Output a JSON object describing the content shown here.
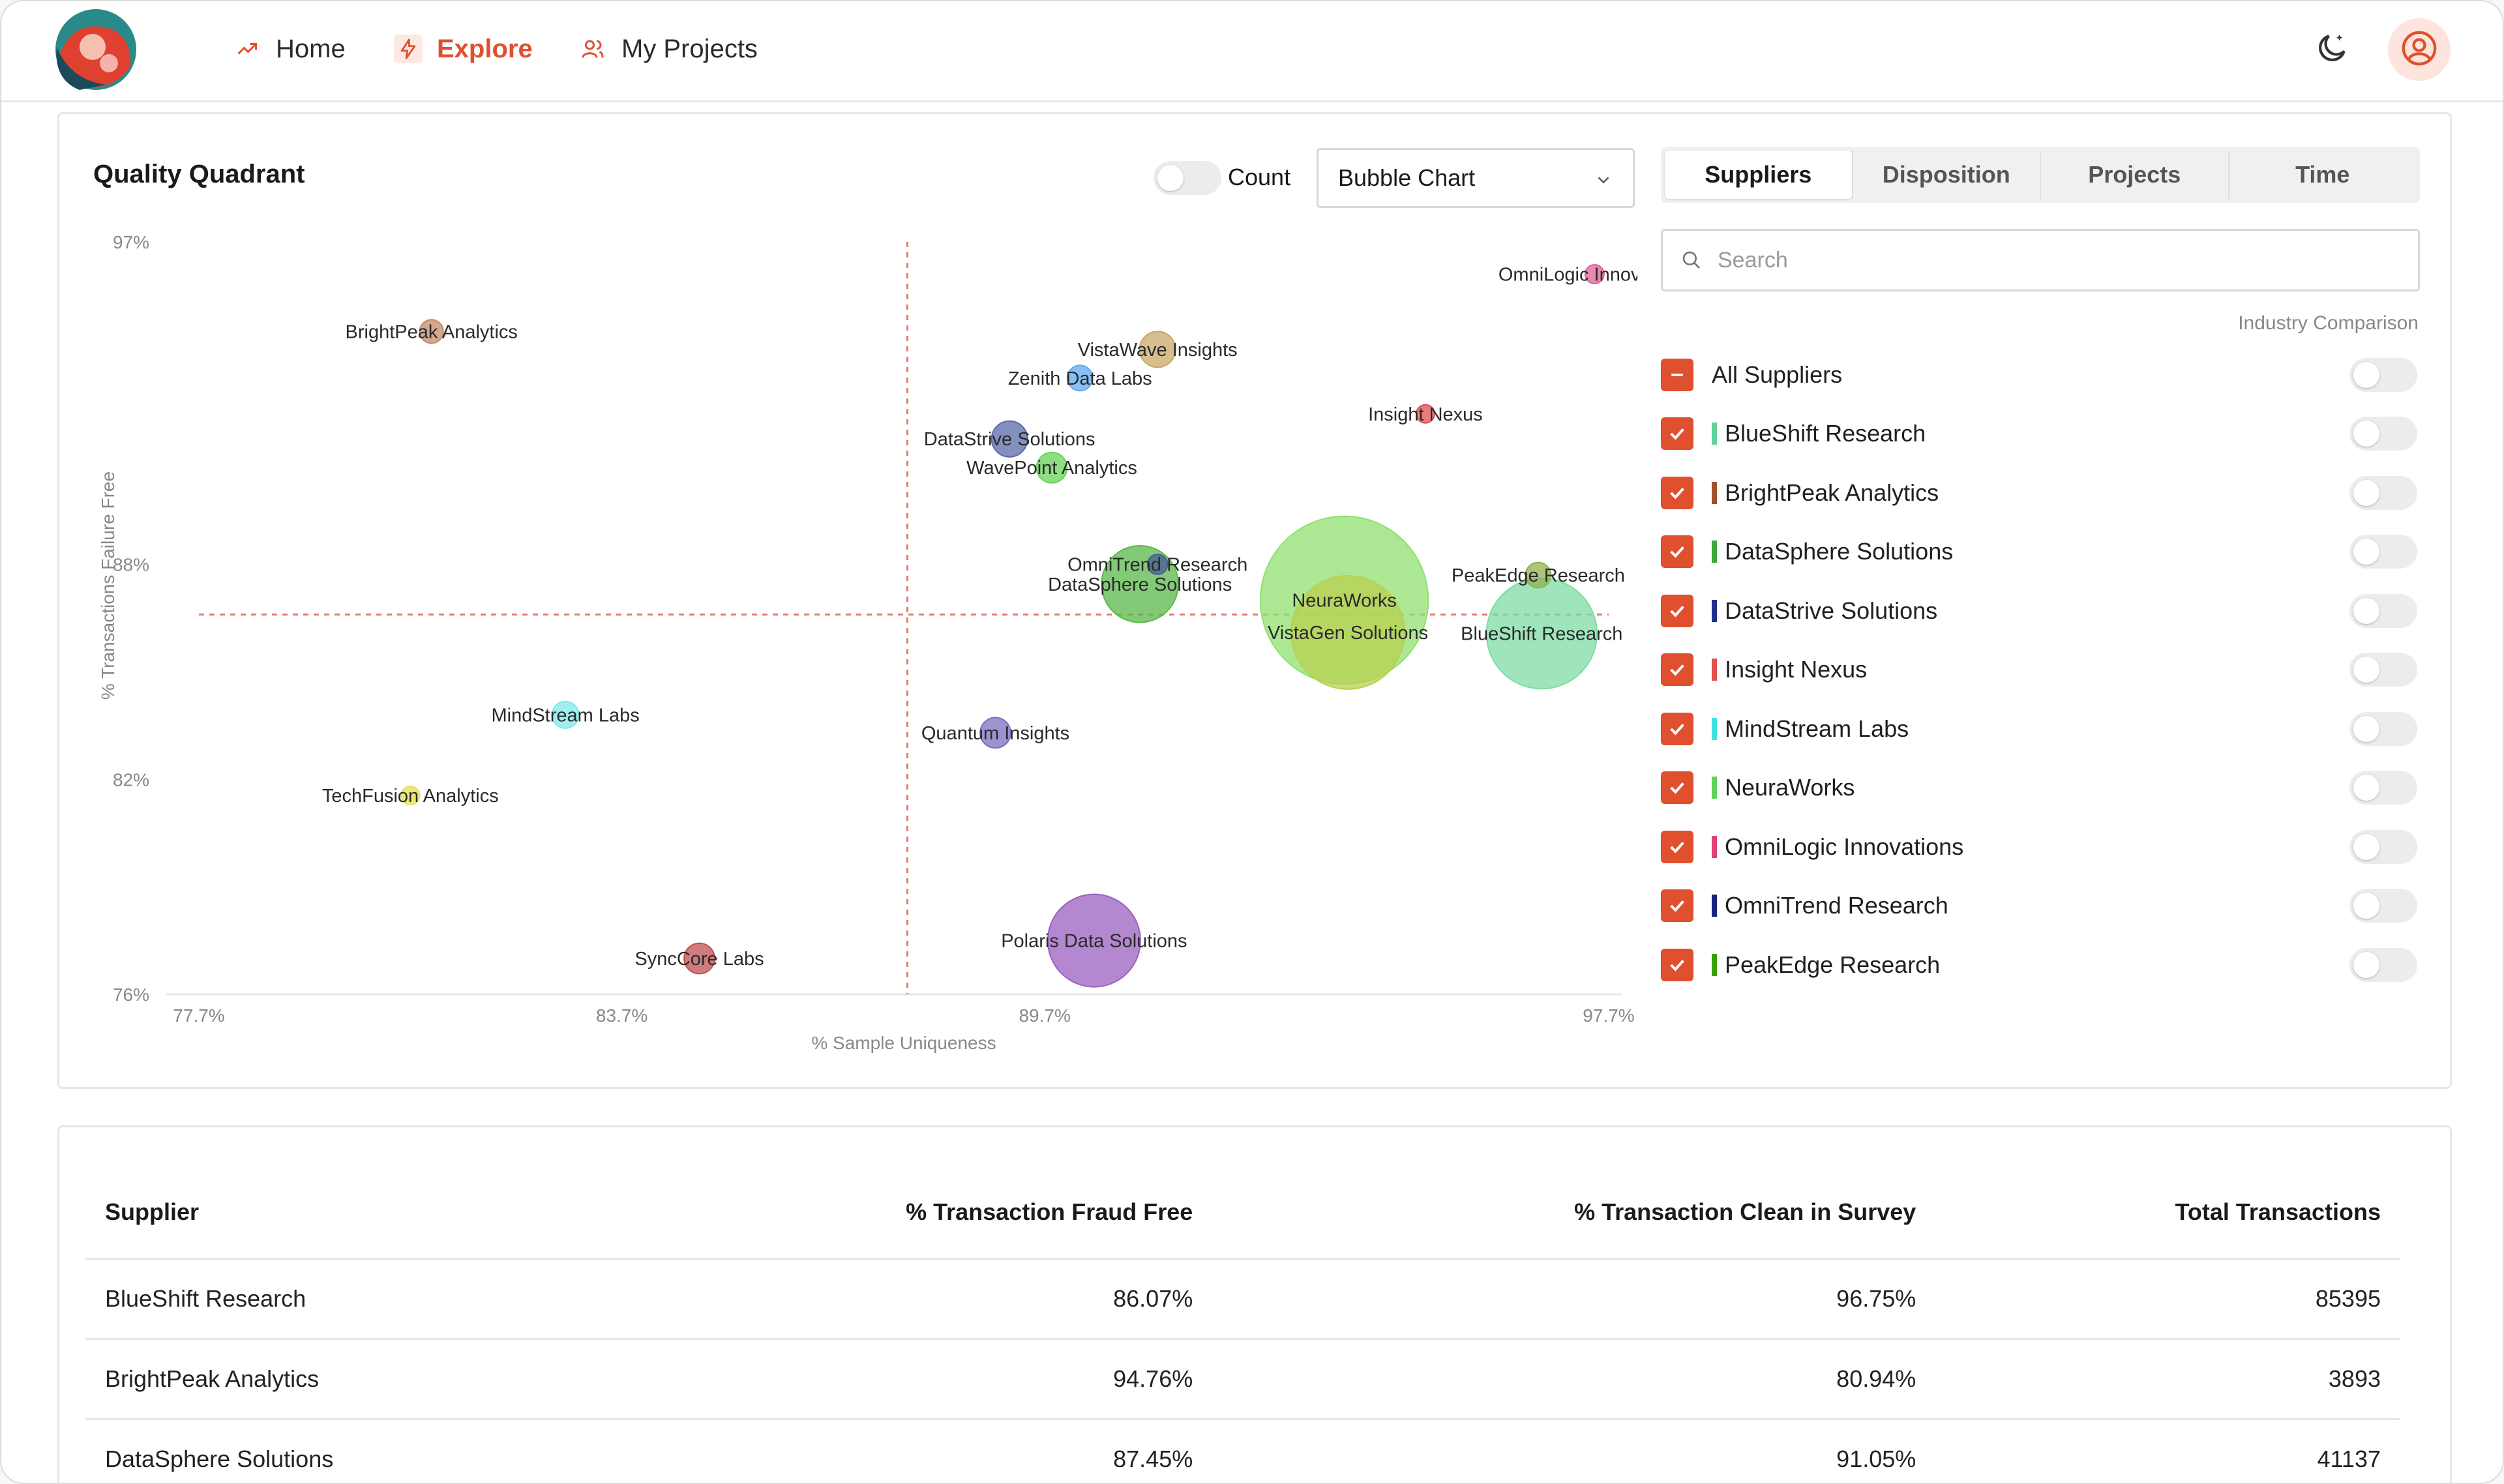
{
  "nav": {
    "home": "Home",
    "explore": "Explore",
    "projects": "My Projects"
  },
  "chart_panel": {
    "title": "Quality Quadrant",
    "count_label": "Count",
    "chart_type_selected": "Bubble Chart"
  },
  "filter_panel": {
    "tabs": [
      "Suppliers",
      "Disposition",
      "Projects",
      "Time"
    ],
    "active_tab": "Suppliers",
    "search_placeholder": "Search",
    "industry_comparison_label": "Industry Comparison",
    "all_label": "All Suppliers",
    "items": [
      {
        "name": "BlueShift Research",
        "color": "#5fd39a",
        "checked": true
      },
      {
        "name": "BrightPeak Analytics",
        "color": "#a0522d",
        "checked": true
      },
      {
        "name": "DataSphere Solutions",
        "color": "#3aa83a",
        "checked": true
      },
      {
        "name": "DataStrive Solutions",
        "color": "#1f2f8f",
        "checked": true
      },
      {
        "name": "Insight Nexus",
        "color": "#e05050",
        "checked": true
      },
      {
        "name": "MindStream Labs",
        "color": "#40e0e0",
        "checked": true
      },
      {
        "name": "NeuraWorks",
        "color": "#5cd35c",
        "checked": true
      },
      {
        "name": "OmniLogic Innovations",
        "color": "#e0407a",
        "checked": true
      },
      {
        "name": "OmniTrend Research",
        "color": "#1a237e",
        "checked": true
      },
      {
        "name": "PeakEdge Research",
        "color": "#3aa000",
        "checked": true
      }
    ]
  },
  "chart_data": {
    "type": "scatter",
    "subtype": "bubble",
    "xlabel": "% Sample Uniqueness",
    "ylabel": "% Transactions Failure Free",
    "x_ticks": [
      "77.7%",
      "83.7%",
      "89.7%",
      "97.7%"
    ],
    "y_ticks": [
      "97%",
      "88%",
      "82%",
      "76%"
    ],
    "xlim": [
      77.7,
      97.7
    ],
    "ylim": [
      76,
      97
    ],
    "x_divider": 87.75,
    "y_divider": 86.6,
    "points": [
      {
        "name": "BrightPeak Analytics",
        "x": 81.0,
        "y": 94.5,
        "size": 3893,
        "color": "#c58a6a"
      },
      {
        "name": "OmniLogic Innovations",
        "x": 97.5,
        "y": 96.1,
        "size": 2500,
        "color": "#e0609a"
      },
      {
        "name": "VistaWave Insights",
        "x": 91.3,
        "y": 94.0,
        "size": 9000,
        "color": "#c8a86a"
      },
      {
        "name": "Zenith Data Labs",
        "x": 90.2,
        "y": 93.2,
        "size": 4500,
        "color": "#60aaf0"
      },
      {
        "name": "Insight Nexus",
        "x": 95.1,
        "y": 92.2,
        "size": 2000,
        "color": "#e05050"
      },
      {
        "name": "DataStrive Solutions",
        "x": 89.2,
        "y": 91.5,
        "size": 9000,
        "color": "#5a6aaa"
      },
      {
        "name": "WavePoint Analytics",
        "x": 89.8,
        "y": 90.7,
        "size": 6500,
        "color": "#6ad25a"
      },
      {
        "name": "OmniTrend Research",
        "x": 91.3,
        "y": 88.0,
        "size": 2800,
        "color": "#4a5a9a"
      },
      {
        "name": "DataSphere Solutions",
        "x": 91.05,
        "y": 87.45,
        "size": 41137,
        "color": "#5ab84a"
      },
      {
        "name": "PeakEdge Research",
        "x": 96.7,
        "y": 87.7,
        "size": 4500,
        "color": "#90b050"
      },
      {
        "name": "NeuraWorks",
        "x": 93.95,
        "y": 87.0,
        "size": 197000,
        "color": "#90e070"
      },
      {
        "name": "VistaGen Solutions",
        "x": 94.0,
        "y": 86.1,
        "size": 90000,
        "color": "#b8d050"
      },
      {
        "name": "BlueShift Research",
        "x": 96.75,
        "y": 86.07,
        "size": 85395,
        "color": "#7edca4"
      },
      {
        "name": "MindStream Labs",
        "x": 82.9,
        "y": 83.8,
        "size": 5000,
        "color": "#80e8e8"
      },
      {
        "name": "Quantum Insights",
        "x": 89.0,
        "y": 83.3,
        "size": 6500,
        "color": "#7a70c0"
      },
      {
        "name": "TechFusion Analytics",
        "x": 80.7,
        "y": 81.55,
        "size": 2000,
        "color": "#e8e050"
      },
      {
        "name": "SyncCore Labs",
        "x": 84.8,
        "y": 77.0,
        "size": 6500,
        "color": "#c05050"
      },
      {
        "name": "Polaris Data Solutions",
        "x": 90.4,
        "y": 77.5,
        "size": 60000,
        "color": "#9a60c0"
      }
    ]
  },
  "table": {
    "headers": [
      "Supplier",
      "% Transaction Fraud Free",
      "% Transaction Clean in Survey",
      "Total Transactions"
    ],
    "rows": [
      [
        "BlueShift Research",
        "86.07%",
        "96.75%",
        "85395"
      ],
      [
        "BrightPeak Analytics",
        "94.76%",
        "80.94%",
        "3893"
      ],
      [
        "DataSphere Solutions",
        "87.45%",
        "91.05%",
        "41137"
      ]
    ]
  }
}
